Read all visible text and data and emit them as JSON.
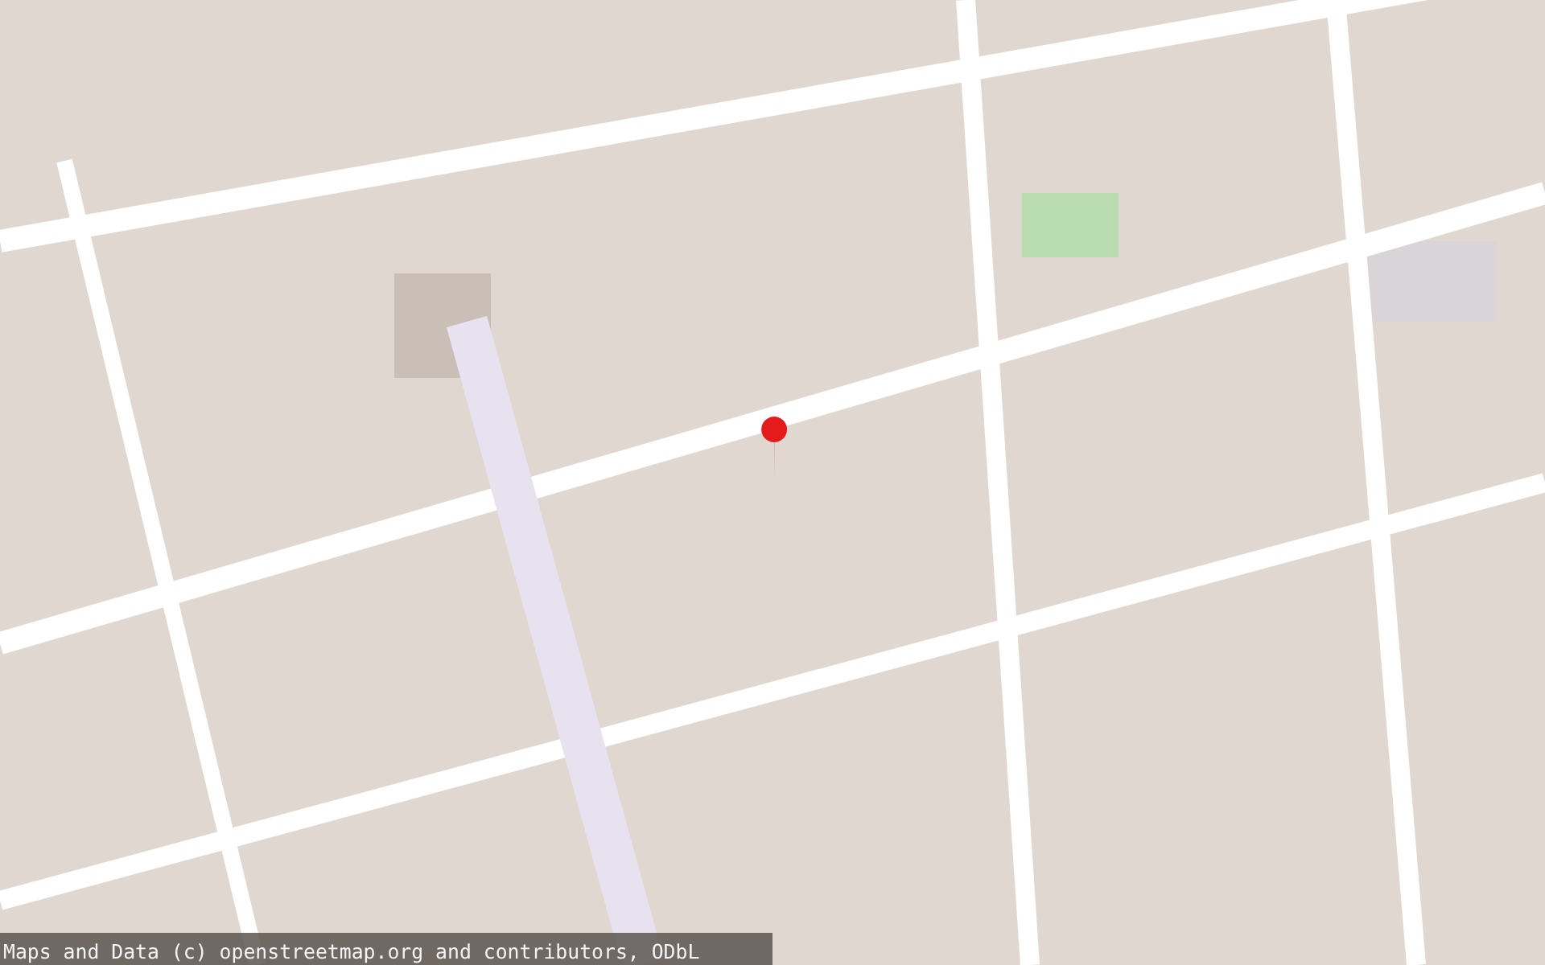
{
  "attribution": {
    "text": "Maps and Data (c) openstreetmap.org and contributors, ODbL"
  }
}
